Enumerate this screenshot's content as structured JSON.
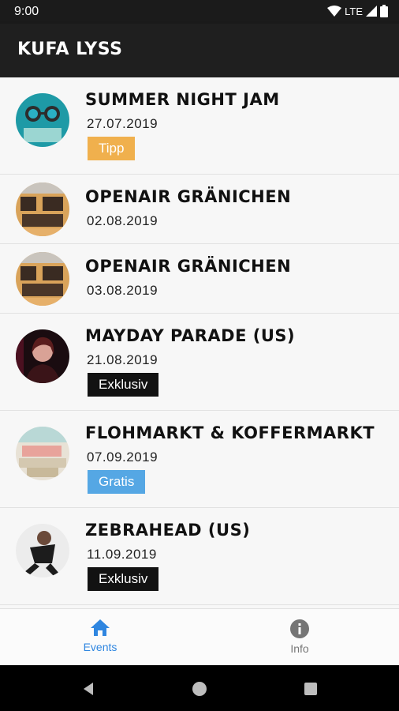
{
  "status_bar": {
    "time": "9:00",
    "network": "LTE"
  },
  "app": {
    "title": "KUFA LYSS"
  },
  "events": [
    {
      "title": "SUMMER NIGHT JAM",
      "date": "27.07.2019",
      "badge": "Tipp"
    },
    {
      "title": "OPENAIR GRÄNICHEN",
      "date": "02.08.2019",
      "badge": ""
    },
    {
      "title": "OPENAIR GRÄNICHEN",
      "date": "03.08.2019",
      "badge": ""
    },
    {
      "title": "MAYDAY PARADE (US)",
      "date": "21.08.2019",
      "badge": "Exklusiv"
    },
    {
      "title": "FLOHMARKT & KOFFERMARKT",
      "date": "07.09.2019",
      "badge": "Gratis"
    },
    {
      "title": "ZEBRAHEAD (US)",
      "date": "11.09.2019",
      "badge": "Exklusiv"
    }
  ],
  "bottom_nav": {
    "events_label": "Events",
    "info_label": "Info",
    "active_color": "#2f86e0"
  },
  "colors": {
    "tipp": "#f0b04d",
    "exklusiv": "#121212",
    "gratis": "#55a7e4"
  }
}
